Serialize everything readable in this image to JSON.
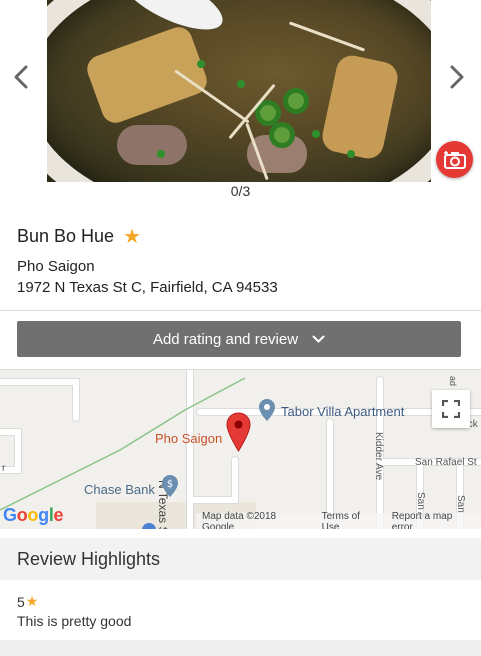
{
  "carousel": {
    "photo_alt": "Bun Bo Hue photo",
    "counter": "0/3",
    "prev_icon": "chevron-left-icon",
    "next_icon": "chevron-right-icon",
    "add_photo_icon": "camera-plus-icon"
  },
  "place": {
    "dish_name": "Bun Bo Hue",
    "favorite_icon": "★",
    "restaurant": "Pho Saigon",
    "address": "1972 N Texas St C, Fairfield, CA 94533"
  },
  "review_button": {
    "label": "Add rating and review",
    "icon": "chevron-down-icon"
  },
  "map": {
    "labels": {
      "tabor": "Tabor Villa Apartment",
      "pho": "Pho Saigon",
      "chase": "Chase Bank",
      "n_texas": "N Texas St",
      "kidder": "Kidder Ave",
      "san_rafael": "San Rafael St",
      "san_a": "San A",
      "san_b": "San",
      "rock": "Rock",
      "aa": "ad",
      "r": "r"
    },
    "footer": {
      "map_data": "Map data ©2018 Google",
      "terms": "Terms of Use",
      "report": "Report a map error"
    },
    "colors": {
      "pin": "#e53935",
      "poi": "#6a8fb0",
      "park_line": "#8bc48a"
    }
  },
  "review_highlights": {
    "title": "Review Highlights",
    "items": [
      {
        "rating": "5",
        "star": "★",
        "text": "This is pretty good"
      }
    ]
  }
}
